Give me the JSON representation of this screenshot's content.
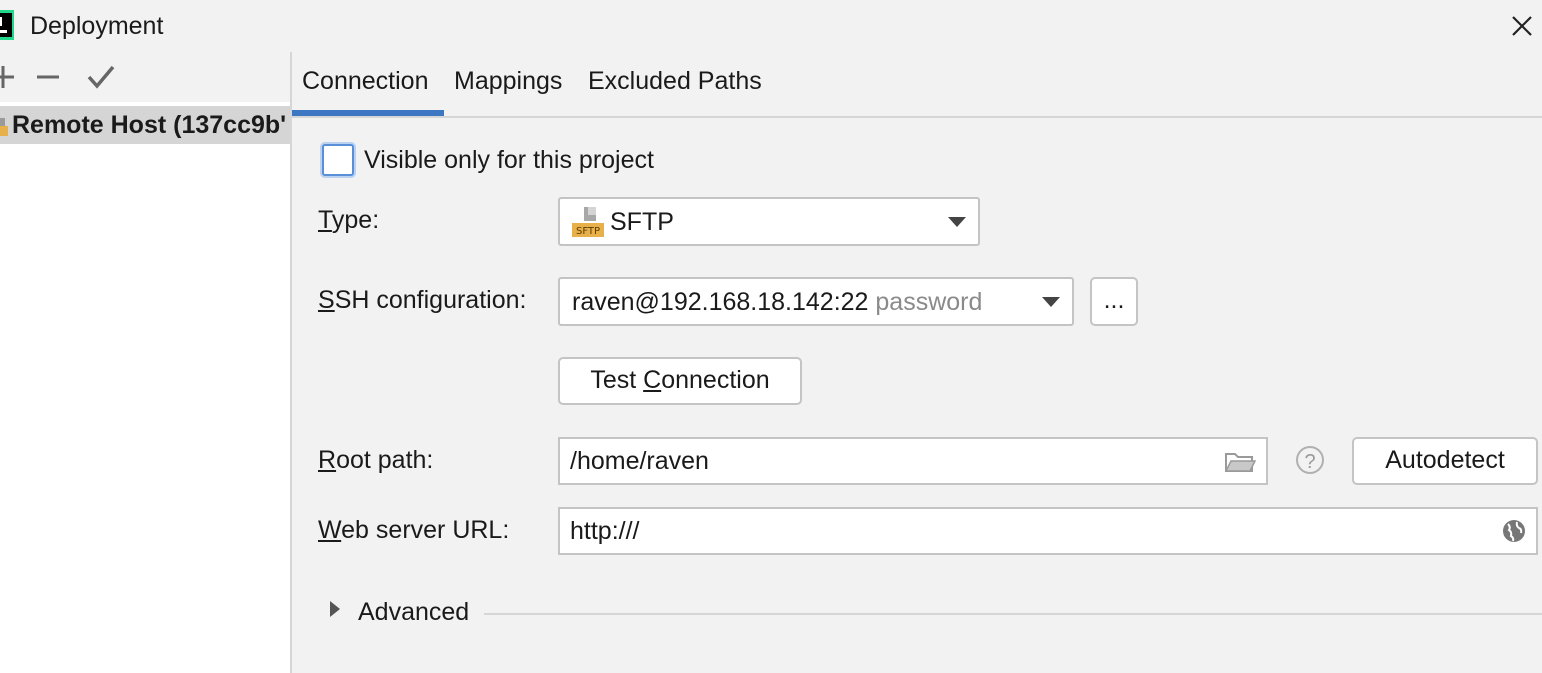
{
  "window": {
    "title": "Deployment",
    "app_icon": "jetbrains-app-icon",
    "close_icon": "close-icon"
  },
  "left_toolbar": {
    "add_icon": "add-icon",
    "remove_icon": "minus-icon",
    "default_icon": "checkmark-icon"
  },
  "servers": [
    {
      "label": "Remote Host (137cc9b'",
      "icon": "sftp-server-icon",
      "selected": true
    }
  ],
  "tabs": [
    {
      "label": "Connection",
      "active": true
    },
    {
      "label": "Mappings",
      "active": false
    },
    {
      "label": "Excluded Paths",
      "active": false
    }
  ],
  "connection": {
    "visible_only_label": "Visible only for this project",
    "visible_only_checked": false,
    "type": {
      "label_mnemonic": "T",
      "label_rest": "ype:",
      "value": "SFTP",
      "icon": "sftp-icon"
    },
    "ssh": {
      "label_mnemonic": "S",
      "label_rest": "SH configuration:",
      "value": "raven@192.168.18.142:22",
      "hint": "password",
      "browse_label": "..."
    },
    "test_button": {
      "prefix": "Test ",
      "mnemonic": "C",
      "suffix": "onnection"
    },
    "root_path": {
      "label_mnemonic": "R",
      "label_rest": "oot path:",
      "value": "/home/raven",
      "folder_icon": "folder-icon",
      "help_icon": "help-icon",
      "help_glyph": "?",
      "autodetect_label": "Autodetect"
    },
    "web_url": {
      "label_mnemonic": "W",
      "label_rest": "eb server URL:",
      "value": "http:///",
      "globe_icon": "globe-icon"
    },
    "advanced": {
      "label": "Advanced",
      "expanded": false
    }
  },
  "colors": {
    "accent": "#3d77c4",
    "selection": "#d5d5d5",
    "sftp_badge": "#e8b04b"
  }
}
